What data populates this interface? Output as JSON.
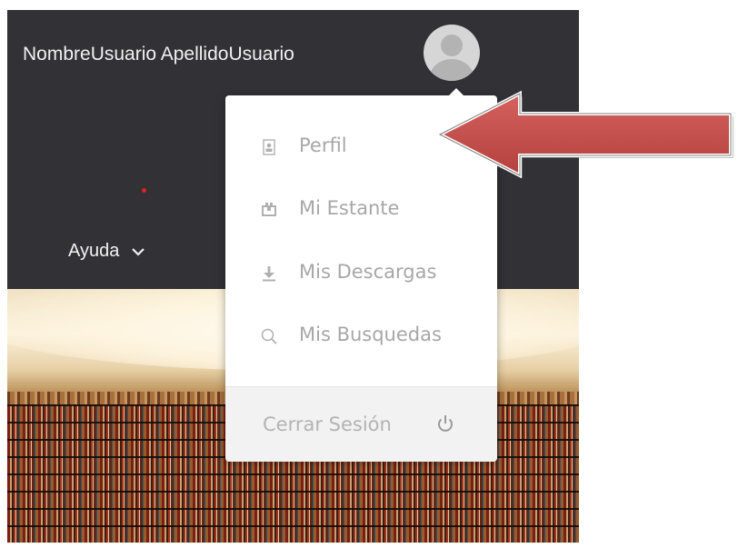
{
  "header": {
    "user_name": "NombreUsuario ApellidoUsuario",
    "help_label": "Ayuda"
  },
  "user_menu": {
    "items": [
      {
        "label": "Perfil",
        "icon": "profile-icon"
      },
      {
        "label": "Mi Estante",
        "icon": "shelf-icon"
      },
      {
        "label": "Mis Descargas",
        "icon": "download-icon"
      },
      {
        "label": "Mis Busquedas",
        "icon": "search-icon"
      }
    ],
    "logout_label": "Cerrar Sesión",
    "logout_icon": "power-icon"
  },
  "colors": {
    "header_bg": "#313136",
    "menu_text": "#a7a7a7",
    "annotation_arrow": "#c0504d",
    "notification_dot": "#e5201b"
  }
}
